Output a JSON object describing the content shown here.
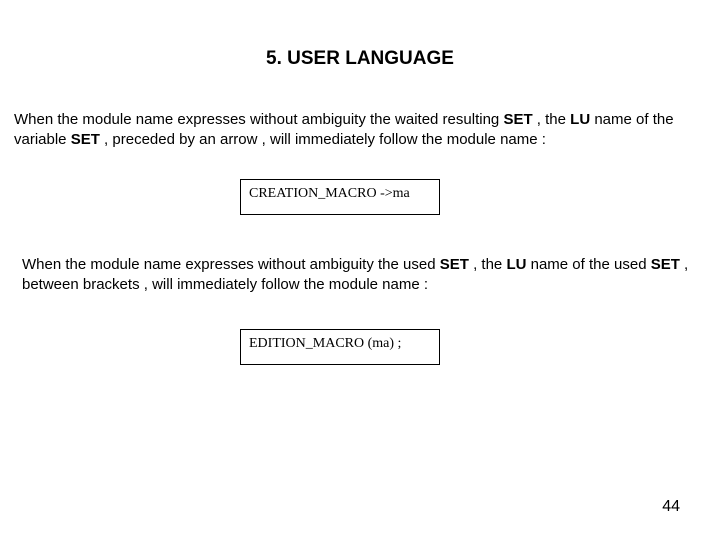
{
  "title": "5. USER LANGUAGE",
  "para1": {
    "t1": "When the module name expresses without ambiguity the waited resulting ",
    "b1": "SET",
    "t2": " , the ",
    "b2": "LU",
    "t3": " name of the variable ",
    "b3": "SET",
    "t4": " , preceded by an arrow , will immediately follow the module name :"
  },
  "code1": "CREATION_MACRO ->ma",
  "para2": {
    "t1": "When the module name expresses without ambiguity the used ",
    "b1": "SET",
    "t2": " , the ",
    "b2": "LU",
    "t3": " name of the used ",
    "b3": "SET",
    "t4": " , between brackets , will immediately follow the module name :"
  },
  "code2": "EDITION_MACRO (ma) ;",
  "pageNumber": "44"
}
